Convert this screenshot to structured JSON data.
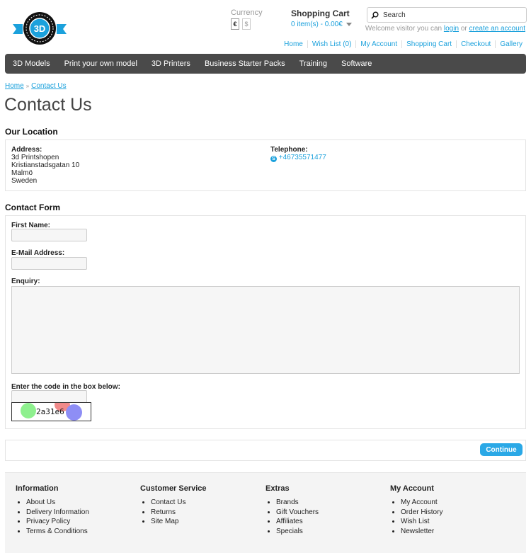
{
  "logo": {
    "text": "3D"
  },
  "currency": {
    "label": "Currency",
    "options": [
      "€",
      "$"
    ],
    "selected": "€"
  },
  "cart": {
    "title": "Shopping Cart",
    "summary": "0 item(s) - 0.00€"
  },
  "search": {
    "placeholder": "Search"
  },
  "welcome": {
    "prefix": "Welcome visitor you can",
    "login": "login",
    "or": "or",
    "create": "create an account"
  },
  "top_links": [
    "Home",
    "Wish List (0)",
    "My Account",
    "Shopping Cart",
    "Checkout",
    "Gallery"
  ],
  "menu": [
    "3D Models",
    "Print your own model",
    "3D Printers",
    "Business Starter Packs",
    "Training",
    "Software"
  ],
  "breadcrumb": {
    "home": "Home",
    "sep": "»",
    "current": "Contact Us"
  },
  "page_title": "Contact Us",
  "location": {
    "heading": "Our Location",
    "address_label": "Address:",
    "address_lines": [
      "3d Printshopen",
      "Kristianstadsgatan 10",
      "Malmö",
      "Sweden"
    ],
    "telephone_label": "Telephone:",
    "telephone": "+46735571477"
  },
  "form": {
    "heading": "Contact Form",
    "first_name_label": "First Name:",
    "email_label": "E-Mail Address:",
    "enquiry_label": "Enquiry:",
    "captcha_label": "Enter the code in the box below:",
    "captcha_code": "2a31e6",
    "continue_label": "Continue"
  },
  "footer": {
    "columns": [
      {
        "heading": "Information",
        "items": [
          "About Us",
          "Delivery Information",
          "Privacy Policy",
          "Terms & Conditions"
        ]
      },
      {
        "heading": "Customer Service",
        "items": [
          "Contact Us",
          "Returns",
          "Site Map"
        ]
      },
      {
        "heading": "Extras",
        "items": [
          "Brands",
          "Gift Vouchers",
          "Affiliates",
          "Specials"
        ]
      },
      {
        "heading": "My Account",
        "items": [
          "My Account",
          "Order History",
          "Wish List",
          "Newsletter"
        ]
      }
    ]
  },
  "colors": {
    "accent": "#1ba1dc",
    "menu_bg": "#4a4a4a",
    "button": "#2aa8e6"
  }
}
